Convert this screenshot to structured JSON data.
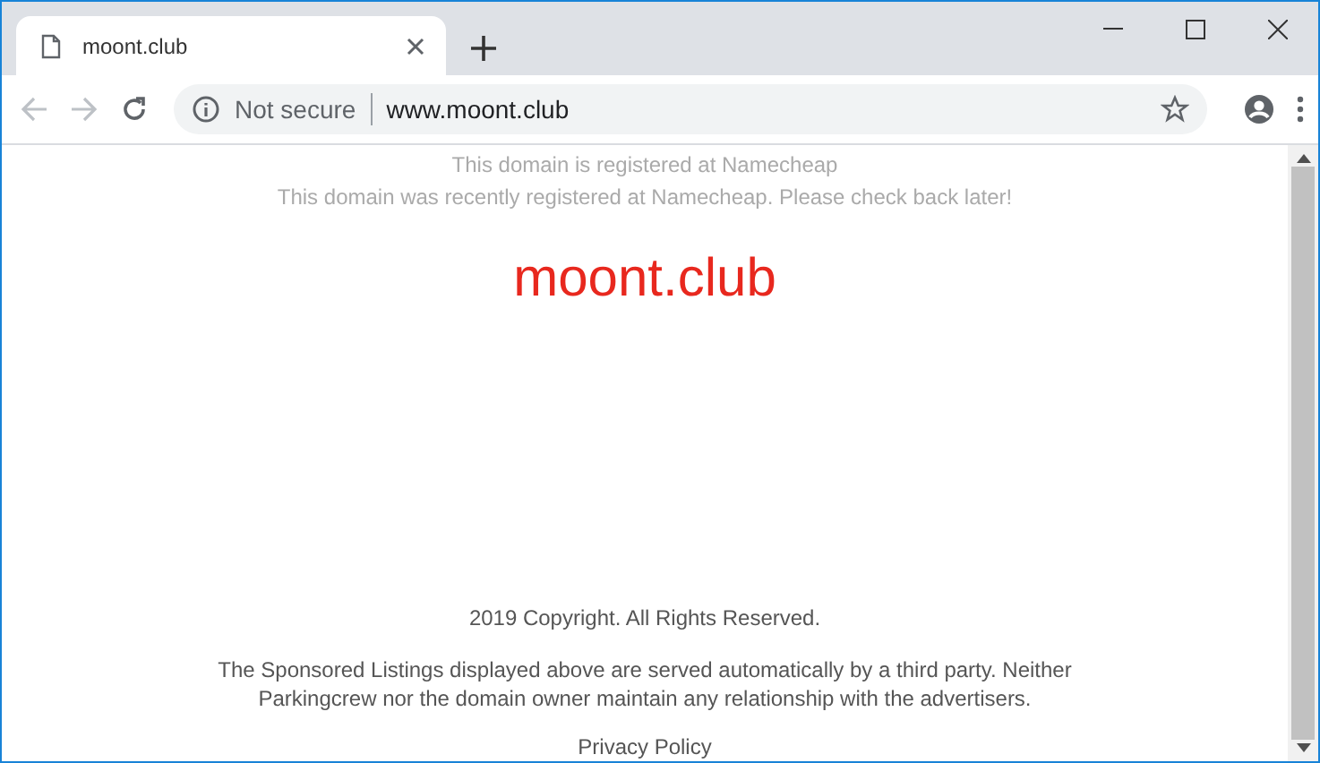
{
  "tabs": [
    {
      "title": "moont.club",
      "selected": true
    }
  ],
  "address_bar": {
    "security": "Not secure",
    "url": "www.moont.club"
  },
  "page": {
    "notice": "This domain is registered at Namecheap",
    "subnotice": "This domain was recently registered at Namecheap. Please check back later!",
    "domain": "moont.club",
    "copyright": "2019 Copyright. All Rights Reserved.",
    "disclaimer": "The Sponsored Listings displayed above are served automatically by a third party. Neither Parkingcrew nor the domain owner maintain any relationship with the advertisers.",
    "privacy_link": "Privacy Policy"
  }
}
